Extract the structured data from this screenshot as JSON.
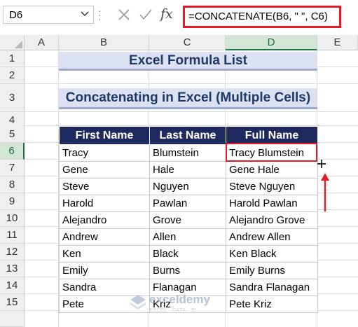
{
  "formula_bar": {
    "name_box": "D6",
    "fx_label": "fx",
    "formula": "=CONCATENATE(B6, \" \", C6)"
  },
  "columns": [
    "A",
    "B",
    "C",
    "D",
    "E"
  ],
  "rows": [
    "1",
    "2",
    "3",
    "4",
    "5",
    "6",
    "7",
    "8",
    "9",
    "10",
    "11",
    "12",
    "13",
    "14",
    "15"
  ],
  "sheet": {
    "title": "Excel Formula List",
    "subtitle": "Concatenating in Excel (Multiple Cells)",
    "table": {
      "headers": [
        "First Name",
        "Last Name",
        "Full Name"
      ],
      "rows": [
        [
          "Tracy",
          "Blumstein",
          "Tracy Blumstein"
        ],
        [
          "Gene",
          "Hale",
          "Gene Hale"
        ],
        [
          "Steve",
          "Nguyen",
          "Steve Nguyen"
        ],
        [
          "Harold",
          "Pawlan",
          "Harold Pawlan"
        ],
        [
          "Alejandro",
          "Grove",
          "Alejandro Grove"
        ],
        [
          "Andrew",
          "Allen",
          "Andrew Allen"
        ],
        [
          "Ken",
          "Black",
          "Ken Black"
        ],
        [
          "Emily",
          "Burns",
          "Emily Burns"
        ],
        [
          "Sandra",
          "Flanagan",
          "Sandra Flanagan"
        ],
        [
          "Pete",
          "Kriz",
          "Pete Kriz"
        ]
      ]
    }
  },
  "selection": {
    "cell": "D6",
    "active_column": "D",
    "active_row": "6"
  },
  "watermark": {
    "name": "exceldemy",
    "tagline": "EXCEL · DATA · BI"
  },
  "colors": {
    "header_fill": "#1e2a5e",
    "banner_fill": "#dbe1f1",
    "highlight_red": "#e01b24",
    "excel_green": "#217346"
  },
  "icons": [
    "chevron-down-icon",
    "cancel-icon",
    "enter-icon",
    "fx-icon",
    "fill-handle-cross-icon",
    "up-arrow-icon",
    "exceldemy-logo-icon"
  ]
}
